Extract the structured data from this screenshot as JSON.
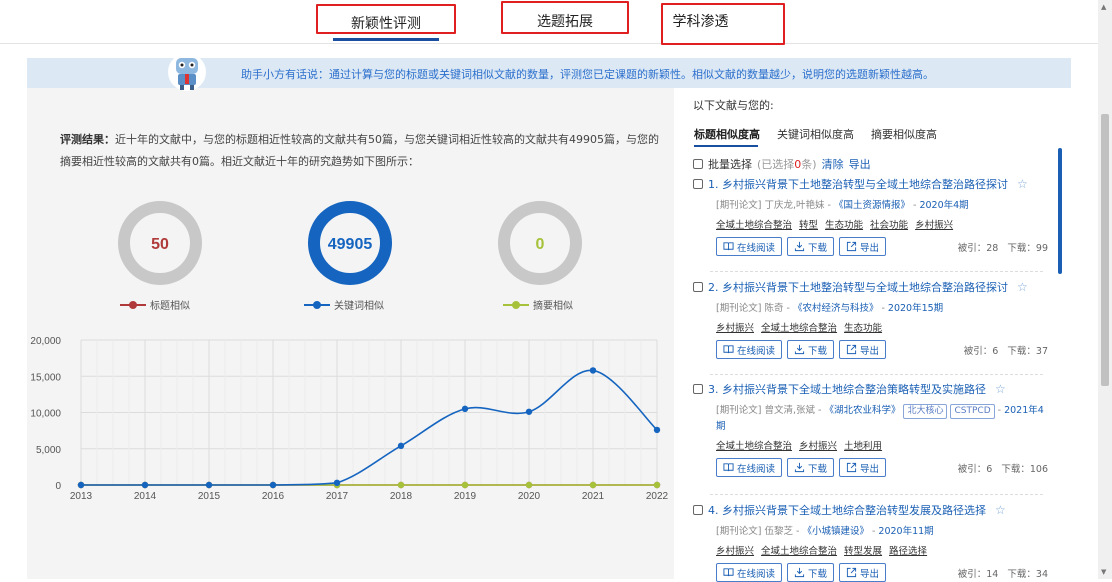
{
  "tabs": [
    {
      "label": "新颖性评测"
    },
    {
      "label": "选题拓展"
    },
    {
      "label": "学科渗透"
    }
  ],
  "banner": {
    "prefix": "助手小方有话说：",
    "text": "通过计算与您的标题或关键词相似文献的数量，评测您已定课题的新颖性。相似文献的数量越少，说明您的选题新颖性越高。"
  },
  "result": {
    "label": "评测结果：",
    "text": "近十年的文献中，与您的标题相近性较高的文献共有50篇，与您关键词相近性较高的文献共有49905篇，与您的摘要相近性较高的文献共有0篇。相近文献近十年的研究趋势如下图所示："
  },
  "donuts": [
    {
      "value": "50",
      "label": "标题相似",
      "color": "#b03a3a",
      "ring": "#c8c8c8"
    },
    {
      "value": "49905",
      "label": "关键词相似",
      "color": "#1565c0",
      "ring": "#1565c0"
    },
    {
      "value": "0",
      "label": "摘要相似",
      "color": "#a6c23a",
      "ring": "#c8c8c8"
    }
  ],
  "chart_data": {
    "type": "line",
    "x": [
      "2013",
      "2014",
      "2015",
      "2016",
      "2017",
      "2018",
      "2019",
      "2020",
      "2021",
      "2022"
    ],
    "ylim": [
      0,
      20000
    ],
    "yticks": [
      "0",
      "5,000",
      "10,000",
      "15,000",
      "20,000"
    ],
    "series": [
      {
        "name": "关键词相似",
        "color": "#1565c0",
        "values": [
          0,
          0,
          0,
          0,
          300,
          5400,
          10500,
          10100,
          15800,
          7600
        ]
      },
      {
        "name": "标题相似",
        "color": "#b03a3a",
        "values": [
          0,
          0,
          0,
          0,
          0,
          0,
          0,
          0,
          0,
          0
        ]
      },
      {
        "name": "摘要相似",
        "color": "#a6c23a",
        "values": [
          0,
          0,
          0,
          0,
          0,
          0,
          0,
          0,
          0,
          0
        ]
      }
    ],
    "grid": true
  },
  "right": {
    "title": "以下文献与您的:",
    "tabs": [
      "标题相似度高",
      "关键词相似度高",
      "摘要相似度高"
    ],
    "batch_label": "批量选择",
    "selected_prefix": "(已选择",
    "selected_count": "0",
    "selected_suffix": "条)",
    "clear": "清除",
    "export": "导出"
  },
  "buttons": {
    "read": "在线阅读",
    "download": "下载",
    "export": "导出"
  },
  "items": [
    {
      "title": "1. 乡村振兴背景下土地整治转型与全域土地综合整治路径探讨",
      "type": "[期刊论文]",
      "authors": "丁庆龙,叶艳妹",
      "source": "《国土资源情报》",
      "year": "2020年4期",
      "tags": [],
      "keywords": [
        "全域土地综合整治",
        "转型",
        "生态功能",
        "社会功能",
        "乡村振兴"
      ],
      "cited": "被引：28",
      "downloads": "下载：99"
    },
    {
      "title": "2. 乡村振兴背景下土地整治转型与全域土地综合整治路径探讨",
      "type": "[期刊论文]",
      "authors": "陈奇",
      "source": "《农村经济与科技》",
      "year": "2020年15期",
      "tags": [],
      "keywords": [
        "乡村振兴",
        "全域土地综合整治",
        "生态功能"
      ],
      "cited": "被引：6",
      "downloads": "下载：37"
    },
    {
      "title": "3. 乡村振兴背景下全域土地综合整治策略转型及实施路径",
      "type": "[期刊论文]",
      "authors": "曾文清,张斌",
      "source": "《湖北农业科学》",
      "year": "2021年4期",
      "tags": [
        "北大核心",
        "CSTPCD"
      ],
      "keywords": [
        "全域土地综合整治",
        "乡村振兴",
        "土地利用"
      ],
      "cited": "被引：6",
      "downloads": "下载：106"
    },
    {
      "title": "4. 乡村振兴背景下全域土地综合整治转型发展及路径选择",
      "type": "[期刊论文]",
      "authors": "伍黎芝",
      "source": "《小城镇建设》",
      "year": "2020年11期",
      "tags": [],
      "keywords": [
        "乡村振兴",
        "全域土地综合整治",
        "转型发展",
        "路径选择"
      ],
      "cited": "被引：14",
      "downloads": "下载：34"
    }
  ]
}
